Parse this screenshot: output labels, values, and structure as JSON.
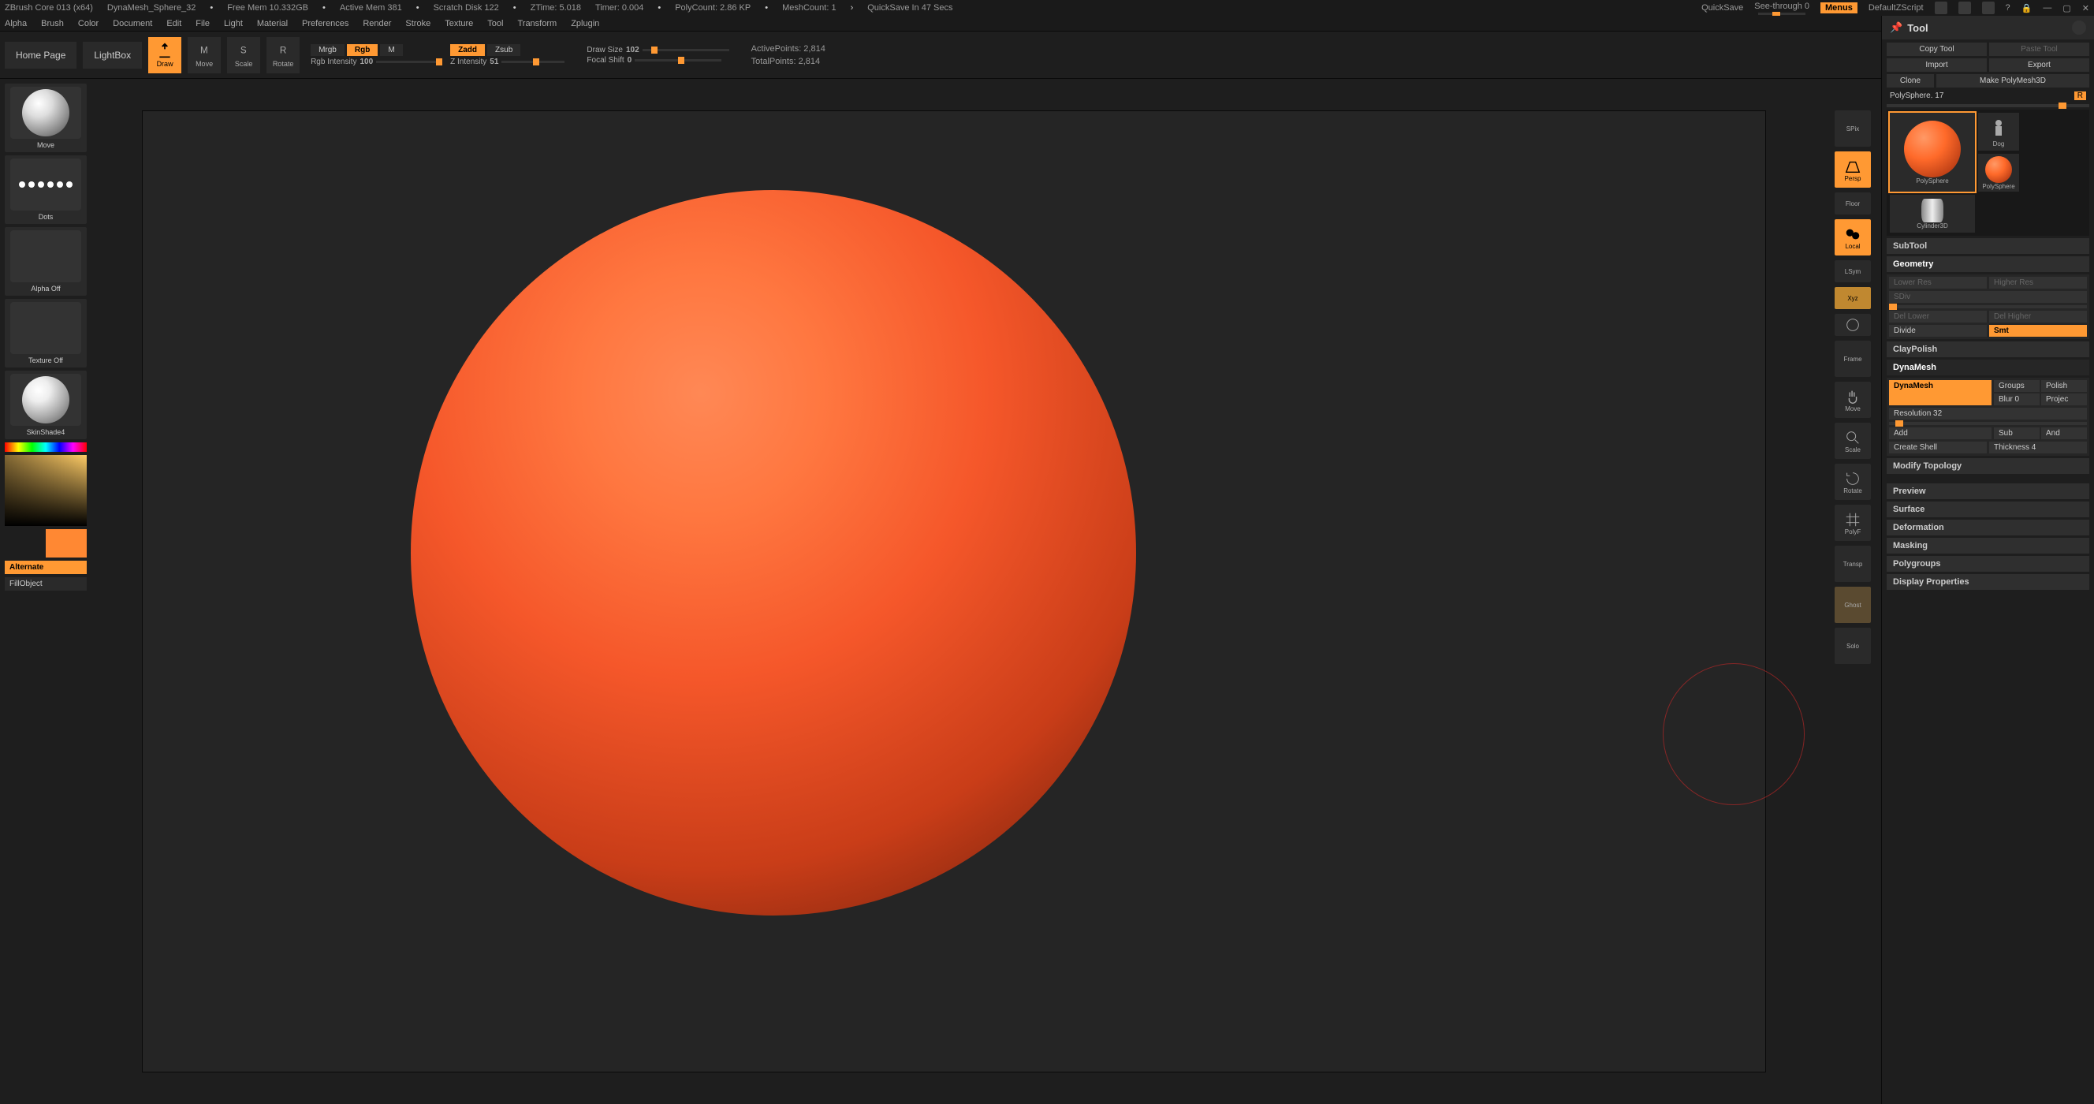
{
  "titlebar": {
    "app": "ZBrush Core 013 (x64)",
    "doc": "DynaMesh_Sphere_32",
    "freemem": "Free Mem 10.332GB",
    "activemem": "Active Mem 381",
    "scratch": "Scratch Disk 122",
    "ztime": "ZTime: 5.018",
    "timer": "Timer: 0.004",
    "polycount": "PolyCount: 2.86 KP",
    "meshcount": "MeshCount: 1",
    "quicksave_in": "QuickSave In 47 Secs",
    "quicksave": "QuickSave",
    "seethrough": "See-through  0",
    "menus": "Menus",
    "defaultzscript": "DefaultZScript"
  },
  "menubar": [
    "Alpha",
    "Brush",
    "Color",
    "Document",
    "Edit",
    "File",
    "Light",
    "Material",
    "Preferences",
    "Render",
    "Stroke",
    "Texture",
    "Tool",
    "Transform",
    "Zplugin"
  ],
  "ribbon": {
    "home": "Home Page",
    "lightbox": "LightBox",
    "modes": {
      "draw": "Draw",
      "move": "Move",
      "scale": "Scale",
      "rotate": "Rotate"
    },
    "mrgb": "Mrgb",
    "rgb": "Rgb",
    "m": "M",
    "rgb_intensity_label": "Rgb Intensity",
    "rgb_intensity": "100",
    "zadd": "Zadd",
    "zsub": "Zsub",
    "z_intensity_label": "Z Intensity",
    "z_intensity": "51",
    "drawsize_label": "Draw Size",
    "drawsize": "102",
    "focal_label": "Focal Shift",
    "focal": "0",
    "active_pts": "ActivePoints:  2,814",
    "total_pts": "TotalPoints:  2,814"
  },
  "lefttray": {
    "brush": "Move",
    "stroke": "Dots",
    "alpha": "Alpha Off",
    "texture": "Texture Off",
    "material": "SkinShade4",
    "alternate": "Alternate",
    "fillobject": "FillObject",
    "swatch1": "#e8e8e8",
    "swatch2": "#ff8833"
  },
  "rvt": [
    "SPix",
    "Persp",
    "Floor",
    "Local",
    "LSym",
    "Xyz",
    "",
    "Frame",
    "Move",
    "Scale",
    "Rotate",
    "PolyF",
    "Transp",
    "Ghost",
    "Solo"
  ],
  "tool": {
    "title": "Tool",
    "copy": "Copy Tool",
    "paste": "Paste Tool",
    "import": "Import",
    "export": "Export",
    "clone": "Clone",
    "makepoly": "Make PolyMesh3D",
    "name": "PolySphere. 17",
    "r": "R",
    "thumbs": [
      {
        "label": "PolySphere",
        "sel": true,
        "color": "#ff6a2a"
      },
      {
        "label": "Dog",
        "sel": false,
        "color": "#555",
        "human": true
      },
      {
        "label": "PolySphere",
        "sel": false,
        "color": "#ff6a2a",
        "small": true
      },
      {
        "label": "Cylinder3D",
        "sel": false,
        "color": "#ccc",
        "cyl": true
      }
    ],
    "sections": {
      "subtool": "SubTool",
      "geometry": "Geometry",
      "geo": {
        "lower": "Lower Res",
        "higher": "Higher Res",
        "sdiv": "SDiv",
        "dellower": "Del Lower",
        "delhigher": "Del Higher",
        "divide": "Divide",
        "smt": "Smt"
      },
      "claypolish": "ClayPolish",
      "dynamesh": "DynaMesh",
      "dyn": {
        "btn": "DynaMesh",
        "groups": "Groups",
        "polish": "Polish",
        "blur": "Blur 0",
        "project": "Projec",
        "res": "Resolution 32",
        "add": "Add",
        "sub": "Sub",
        "and": "And",
        "create": "Create Shell",
        "thick": "Thickness 4"
      },
      "modtop": "Modify Topology",
      "preview": "Preview",
      "surface": "Surface",
      "deformation": "Deformation",
      "masking": "Masking",
      "polygroups": "Polygroups",
      "display": "Display Properties"
    }
  }
}
